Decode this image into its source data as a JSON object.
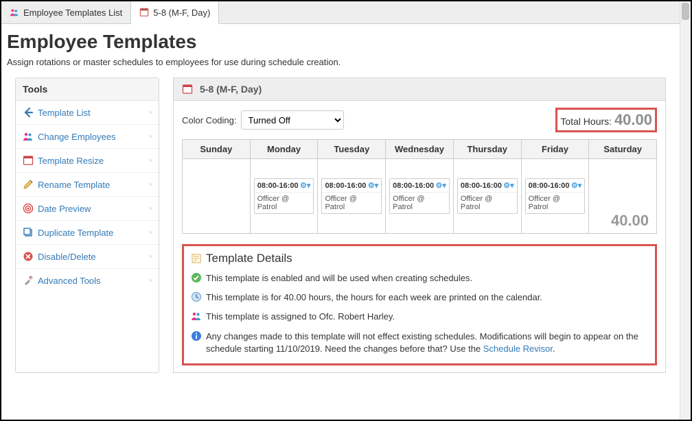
{
  "tabs": [
    {
      "label": "Employee Templates List"
    },
    {
      "label": "5-8 (M-F, Day)"
    }
  ],
  "page": {
    "title": "Employee Templates",
    "subtitle": "Assign rotations or master schedules to employees for use during schedule creation."
  },
  "sidebar": {
    "header": "Tools",
    "items": [
      {
        "label": "Template List"
      },
      {
        "label": "Change Employees"
      },
      {
        "label": "Template Resize"
      },
      {
        "label": "Rename Template"
      },
      {
        "label": "Date Preview"
      },
      {
        "label": "Duplicate Template"
      },
      {
        "label": "Disable/Delete"
      },
      {
        "label": "Advanced Tools"
      }
    ]
  },
  "detail": {
    "title": "5-8 (M-F, Day)",
    "colorCodingLabel": "Color Coding:",
    "colorCodingValue": "Turned Off",
    "totalHoursLabel": "Total Hours:",
    "totalHoursValue": "40.00"
  },
  "days": [
    {
      "name": "Sunday",
      "shift": null
    },
    {
      "name": "Monday",
      "shift": {
        "time": "08:00-16:00",
        "desc": "Officer @ Patrol"
      }
    },
    {
      "name": "Tuesday",
      "shift": {
        "time": "08:00-16:00",
        "desc": "Officer @ Patrol"
      }
    },
    {
      "name": "Wednesday",
      "shift": {
        "time": "08:00-16:00",
        "desc": "Officer @ Patrol"
      }
    },
    {
      "name": "Thursday",
      "shift": {
        "time": "08:00-16:00",
        "desc": "Officer @ Patrol"
      }
    },
    {
      "name": "Friday",
      "shift": {
        "time": "08:00-16:00",
        "desc": "Officer @ Patrol"
      }
    },
    {
      "name": "Saturday",
      "shift": null,
      "rowTotal": "40.00"
    }
  ],
  "templateDetails": {
    "heading": "Template Details",
    "enabled": "This template is enabled and will be used when creating schedules.",
    "hours": "This template is for 40.00 hours, the hours for each week are printed on the calendar.",
    "assigned": "This template is assigned to Ofc. Robert Harley.",
    "changesPre": "Any changes made to this template will not effect existing schedules. Modifications will begin to appear on the schedule starting 11/10/2019. Need the changes before that? Use the ",
    "revisorLink": "Schedule Revisor",
    "changesPost": "."
  }
}
